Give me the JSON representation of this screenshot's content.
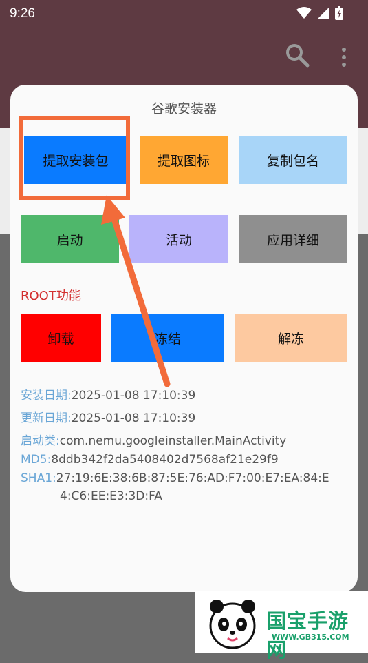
{
  "status": {
    "time": "9:26"
  },
  "dialog": {
    "title": "谷歌安装器",
    "row1": [
      "提取安装包",
      "提取图标",
      "复制包名"
    ],
    "row2": [
      "启动",
      "活动",
      "应用详细"
    ],
    "root_title": "ROOT功能",
    "row3": [
      "卸载",
      "冻结",
      "解冻"
    ],
    "info": {
      "install_key": "安装日期:",
      "install_val": "2025-01-08 17:10:39",
      "update_key": "更新日期:",
      "update_val": "2025-01-08 17:10:39",
      "launch_key": "启动类:",
      "launch_val": "com.nemu.googleinstaller.MainActivity",
      "md5_key": "MD5:",
      "md5_val": "8ddb342f2da5408402d7568af21e29f9",
      "sha1_key": "SHA1:",
      "sha1_val1": "27:19:6E:38:6B:87:5E:76:AD:F7:00:E7:EA:84:E",
      "sha1_val2": "4:C6:EE:E3:3D:FA"
    }
  },
  "watermark": {
    "brand": "国宝手游网",
    "url": "WWW.GB315.COM"
  },
  "colors": {
    "btn_extract": "#0a7bff",
    "btn_icon": "#ffa733",
    "btn_copy": "#a8d5f8",
    "btn_launch": "#4fb76b",
    "btn_activity": "#b9b3fb",
    "btn_detail": "#8f8f8f",
    "btn_uninstall": "#ff0000",
    "btn_freeze": "#0a7bff",
    "btn_unfreeze": "#fdc9a0",
    "annotation": "#f26b3a"
  }
}
